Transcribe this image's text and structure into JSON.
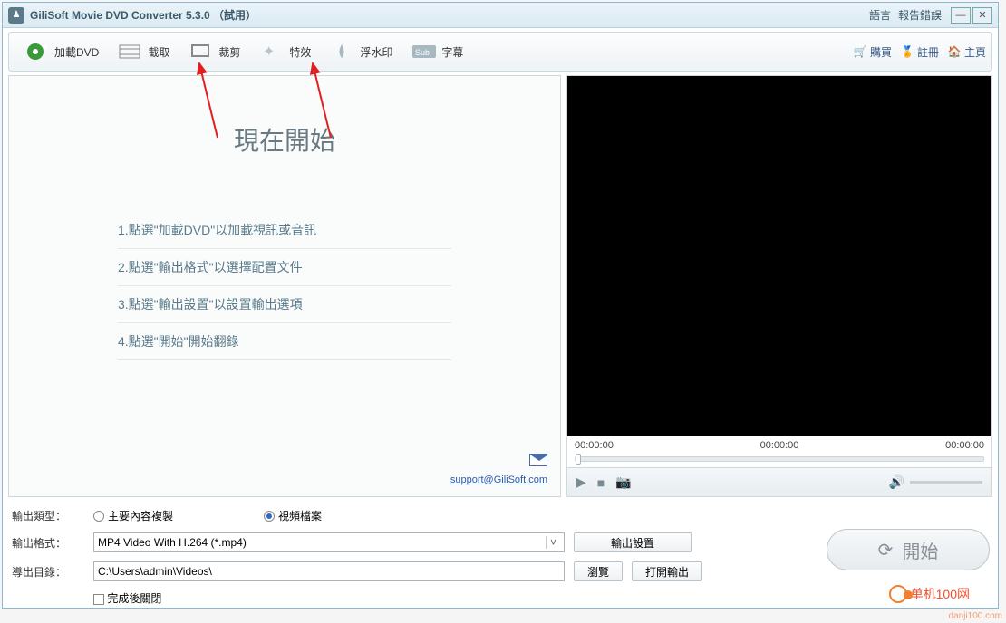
{
  "titlebar": {
    "title": "GiliSoft Movie DVD Converter 5.3.0 （試用）",
    "language": "語言",
    "report": "報告錯誤"
  },
  "toolbar": {
    "load": "加載DVD",
    "clip": "截取",
    "crop": "裁剪",
    "effect": "特效",
    "watermark": "浮水印",
    "subtitle": "字幕",
    "buy": "購買",
    "register": "註冊",
    "home": "主頁"
  },
  "welcome": {
    "title": "現在開始",
    "steps": [
      "1.點選\"加載DVD\"以加載視訊或音訊",
      "2.點選\"輸出格式\"以選擇配置文件",
      "3.點選\"輸出設置\"以設置輸出選項",
      "4.點選\"開始\"開始翻錄"
    ],
    "support": "support@GiliSoft.com"
  },
  "player": {
    "t1": "00:00:00",
    "t2": "00:00:00",
    "t3": "00:00:00"
  },
  "bottom": {
    "outtype_label": "輸出類型：",
    "radio_main": "主要內容複製",
    "radio_video": "視頻檔案",
    "format_label": "輸出格式：",
    "format_value": "MP4 Video With H.264 (*.mp4)",
    "settings_btn": "輸出設置",
    "dest_label": "導出目錄：",
    "dest_value": "C:\\Users\\admin\\Videos\\",
    "browse_btn": "瀏覽",
    "open_btn": "打開輸出",
    "shutdown": "完成後關閉",
    "start_btn": "開始"
  },
  "brand": {
    "name": "单机100网",
    "url": "danji100.com"
  }
}
